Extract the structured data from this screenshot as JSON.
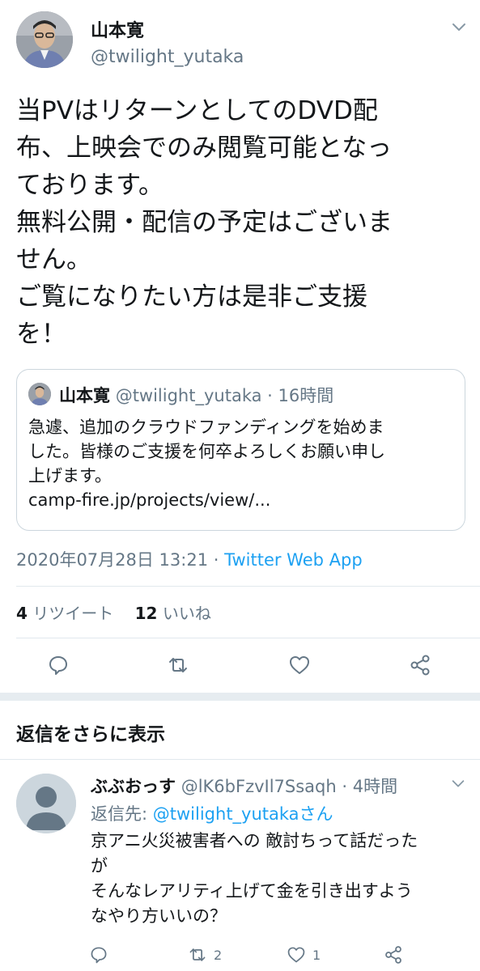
{
  "tweet": {
    "author_name": "山本寛",
    "author_handle": "@twilight_yutaka",
    "body_lines": [
      "当PVはリターンとしてのDVD配",
      "布、上映会でのみ閲覧可能となっ",
      "ております。",
      "無料公開・配信の予定はございま",
      "せん。",
      "ご覧になりたい方は是非ご支援",
      "を！"
    ],
    "quote": {
      "author_name": "山本寛",
      "author_meta": "@twilight_yutaka · 16時間",
      "text_lines": [
        "急遽、追加のクラウドファンディングを始めま",
        "した。皆様のご支援を何卒よろしくお願い申し",
        "上げます。",
        "camp-fire.jp/projects/view/..."
      ]
    },
    "timestamp": "2020年07月28日 13:21 · ",
    "source": "Twitter Web App",
    "retweet_count": "4",
    "retweet_label": "リツイート",
    "like_count": "12",
    "like_label": "いいね"
  },
  "more_replies_label": "返信をさらに表示",
  "reply": {
    "author_name": "ぶぶおっす",
    "author_meta": "@lK6bFzvIl7Ssaqh · 4時間",
    "reply_to_label": "返信先: ",
    "reply_to_handle": "@twilight_yutakaさん",
    "text_lines": [
      "京アニ火災被害者への 敵討ちって話だった",
      "が",
      "そんなレアリティ上げて金を引き出すよう",
      "なやり方いいの？"
    ],
    "retweet_count": "2",
    "like_count": "1"
  },
  "colors": {
    "accent": "#1da1f2",
    "secondary_text": "#657786",
    "primary_text": "#14171a",
    "border": "#ccd6dd"
  },
  "icons": [
    "chevron-down-icon",
    "reply-icon",
    "retweet-icon",
    "like-icon",
    "share-icon",
    "default-avatar-icon"
  ]
}
